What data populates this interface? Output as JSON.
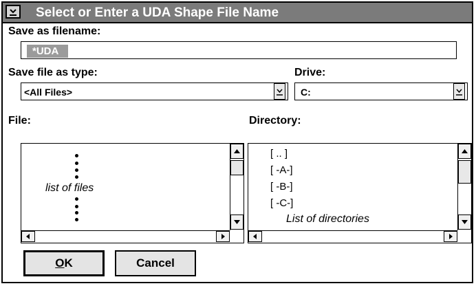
{
  "dialog": {
    "title": "Select or Enter a UDA Shape File Name",
    "system_menu_icon": "chevron-down-underline-icon"
  },
  "save_as": {
    "label": "Save as filename:",
    "value": "*UDA"
  },
  "file_type": {
    "label": "Save file as type:",
    "selected": "<All Files>"
  },
  "drive": {
    "label": "Drive:",
    "selected": "C:"
  },
  "file_list": {
    "label": "File:",
    "placeholder": "list of files"
  },
  "directory_list": {
    "label": "Directory:",
    "items": [
      "[ .. ]",
      "[ -A-]",
      "[ -B-]",
      "[ -C-]"
    ],
    "placeholder": "List of directories"
  },
  "buttons": {
    "ok_prefix": "O",
    "ok_rest": "K",
    "cancel": "Cancel"
  }
}
